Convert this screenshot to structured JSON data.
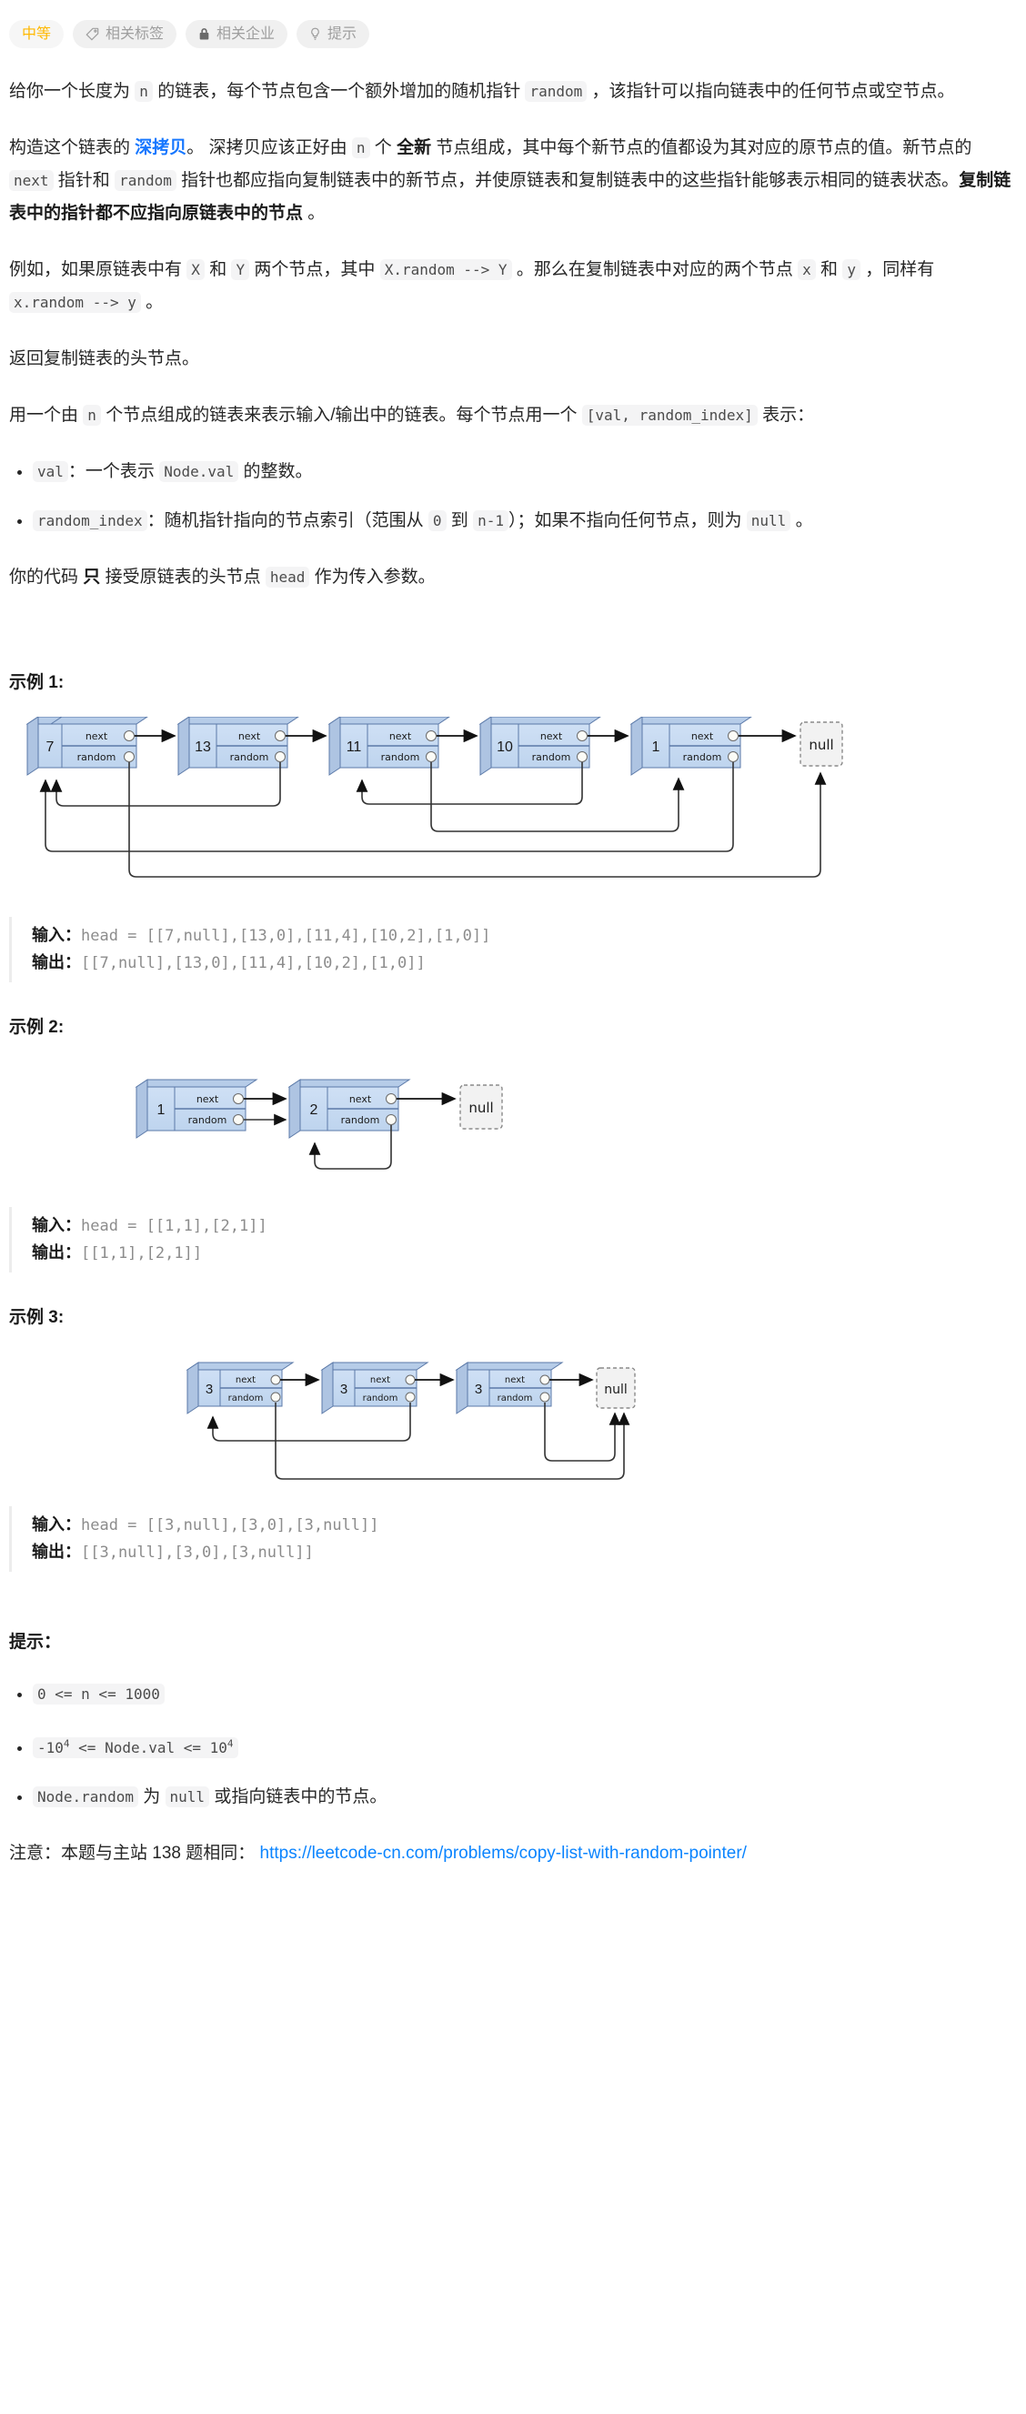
{
  "tags": [
    {
      "label": "中等",
      "icon": "none",
      "kind": "difficulty"
    },
    {
      "label": "相关标签",
      "icon": "tag-icon",
      "kind": "normal"
    },
    {
      "label": "相关企业",
      "icon": "lock-icon",
      "kind": "normal"
    },
    {
      "label": "提示",
      "icon": "lightbulb-icon",
      "kind": "normal"
    }
  ],
  "paragraphs": {
    "p1_a": "给你一个长度为 ",
    "p1_code1": "n",
    "p1_b": " 的链表，每个节点包含一个额外增加的随机指针 ",
    "p1_code2": "random",
    "p1_c": " ，该指针可以指向链表中的任何节点或空节点。",
    "p2_a": "构造这个链表的 ",
    "p2_accent": "深拷贝",
    "p2_b": "。 深拷贝应该正好由 ",
    "p2_code1": "n",
    "p2_c": " 个 ",
    "p2_strong1": "全新",
    "p2_d": " 节点组成，其中每个新节点的值都设为其对应的原节点的值。新节点的 ",
    "p2_code2": "next",
    "p2_e": " 指针和 ",
    "p2_code3": "random",
    "p2_f": " 指针也都应指向复制链表中的新节点，并使原链表和复制链表中的这些指针能够表示相同的链表状态。",
    "p2_strong2": "复制链表中的指针都不应指向原链表中的节点",
    "p2_g": " 。",
    "p3_a": "例如，如果原链表中有 ",
    "p3_code1": "X",
    "p3_b": " 和 ",
    "p3_code2": "Y",
    "p3_c": " 两个节点，其中 ",
    "p3_code3": "X.random --> Y",
    "p3_d": " 。那么在复制链表中对应的两个节点 ",
    "p3_code4": "x",
    "p3_e": " 和 ",
    "p3_code5": "y",
    "p3_f": " ，同样有 ",
    "p3_code6": "x.random --> y",
    "p3_g": " 。",
    "p4": "返回复制链表的头节点。",
    "p5_a": "用一个由 ",
    "p5_code1": "n",
    "p5_b": " 个节点组成的链表来表示输入/输出中的链表。每个节点用一个 ",
    "p5_code2": "[val, random_index]",
    "p5_c": " 表示：",
    "bullet1_code": "val",
    "bullet1_a": "：一个表示 ",
    "bullet1_code2": "Node.val",
    "bullet1_b": " 的整数。",
    "bullet2_code": "random_index",
    "bullet2_a": "：随机指针指向的节点索引（范围从 ",
    "bullet2_code2": "0",
    "bullet2_b": " 到 ",
    "bullet2_code3": "n-1",
    "bullet2_c": "）；如果不指向任何节点，则为 ",
    "bullet2_code4": "null",
    "bullet2_d": " 。",
    "p6_a": "你的代码 ",
    "p6_strong": "只",
    "p6_b": " 接受原链表的头节点 ",
    "p6_code": "head",
    "p6_c": " 作为传入参数。"
  },
  "examples": [
    {
      "heading": "示例 1:",
      "input_label": "输入：",
      "input_value": "head = [[7,null],[13,0],[11,4],[10,2],[1,0]]",
      "output_label": "输出：",
      "output_value": "[[7,null],[13,0],[11,4],[10,2],[1,0]]",
      "nodes": [
        {
          "val": "7",
          "next_label": "next",
          "random_label": "random"
        },
        {
          "val": "13",
          "next_label": "next",
          "random_label": "random"
        },
        {
          "val": "11",
          "next_label": "next",
          "random_label": "random"
        },
        {
          "val": "10",
          "next_label": "next",
          "random_label": "random"
        },
        {
          "val": "1",
          "next_label": "next",
          "random_label": "random"
        }
      ],
      "null_label": "null"
    },
    {
      "heading": "示例 2:",
      "input_label": "输入：",
      "input_value": "head = [[1,1],[2,1]]",
      "output_label": "输出：",
      "output_value": "[[1,1],[2,1]]",
      "nodes": [
        {
          "val": "1",
          "next_label": "next",
          "random_label": "random"
        },
        {
          "val": "2",
          "next_label": "next",
          "random_label": "random"
        }
      ],
      "null_label": "null"
    },
    {
      "heading": "示例 3:",
      "input_label": "输入：",
      "input_value": "head = [[3,null],[3,0],[3,null]]",
      "output_label": "输出：",
      "output_value": "[[3,null],[3,0],[3,null]]",
      "nodes": [
        {
          "val": "3",
          "next_label": "next",
          "random_label": "random"
        },
        {
          "val": "3",
          "next_label": "next",
          "random_label": "random"
        },
        {
          "val": "3",
          "next_label": "next",
          "random_label": "random"
        }
      ],
      "null_label": "null"
    }
  ],
  "hints": {
    "heading": "提示：",
    "items": [
      {
        "code": "0 <= n <= 1000"
      },
      {
        "code_pre": "-10",
        "sup1": "4",
        "code_mid": " <= Node.val <= 10",
        "sup2": "4"
      },
      {
        "code": "Node.random",
        "text_a": " 为 ",
        "code2": "null",
        "text_b": " 或指向链表中的节点。"
      }
    ]
  },
  "note": {
    "prefix": "注意：本题与主站 138 题相同：",
    "link": "https://leetcode-cn.com/problems/copy-list-with-random-pointer/"
  },
  "colors": {
    "node_face": "#c3d7f0",
    "node_top": "#b6cce8",
    "node_border": "#5b79a8",
    "accent": "#1677ff",
    "difficulty": "#ffb800",
    "link": "#0a84ff"
  }
}
